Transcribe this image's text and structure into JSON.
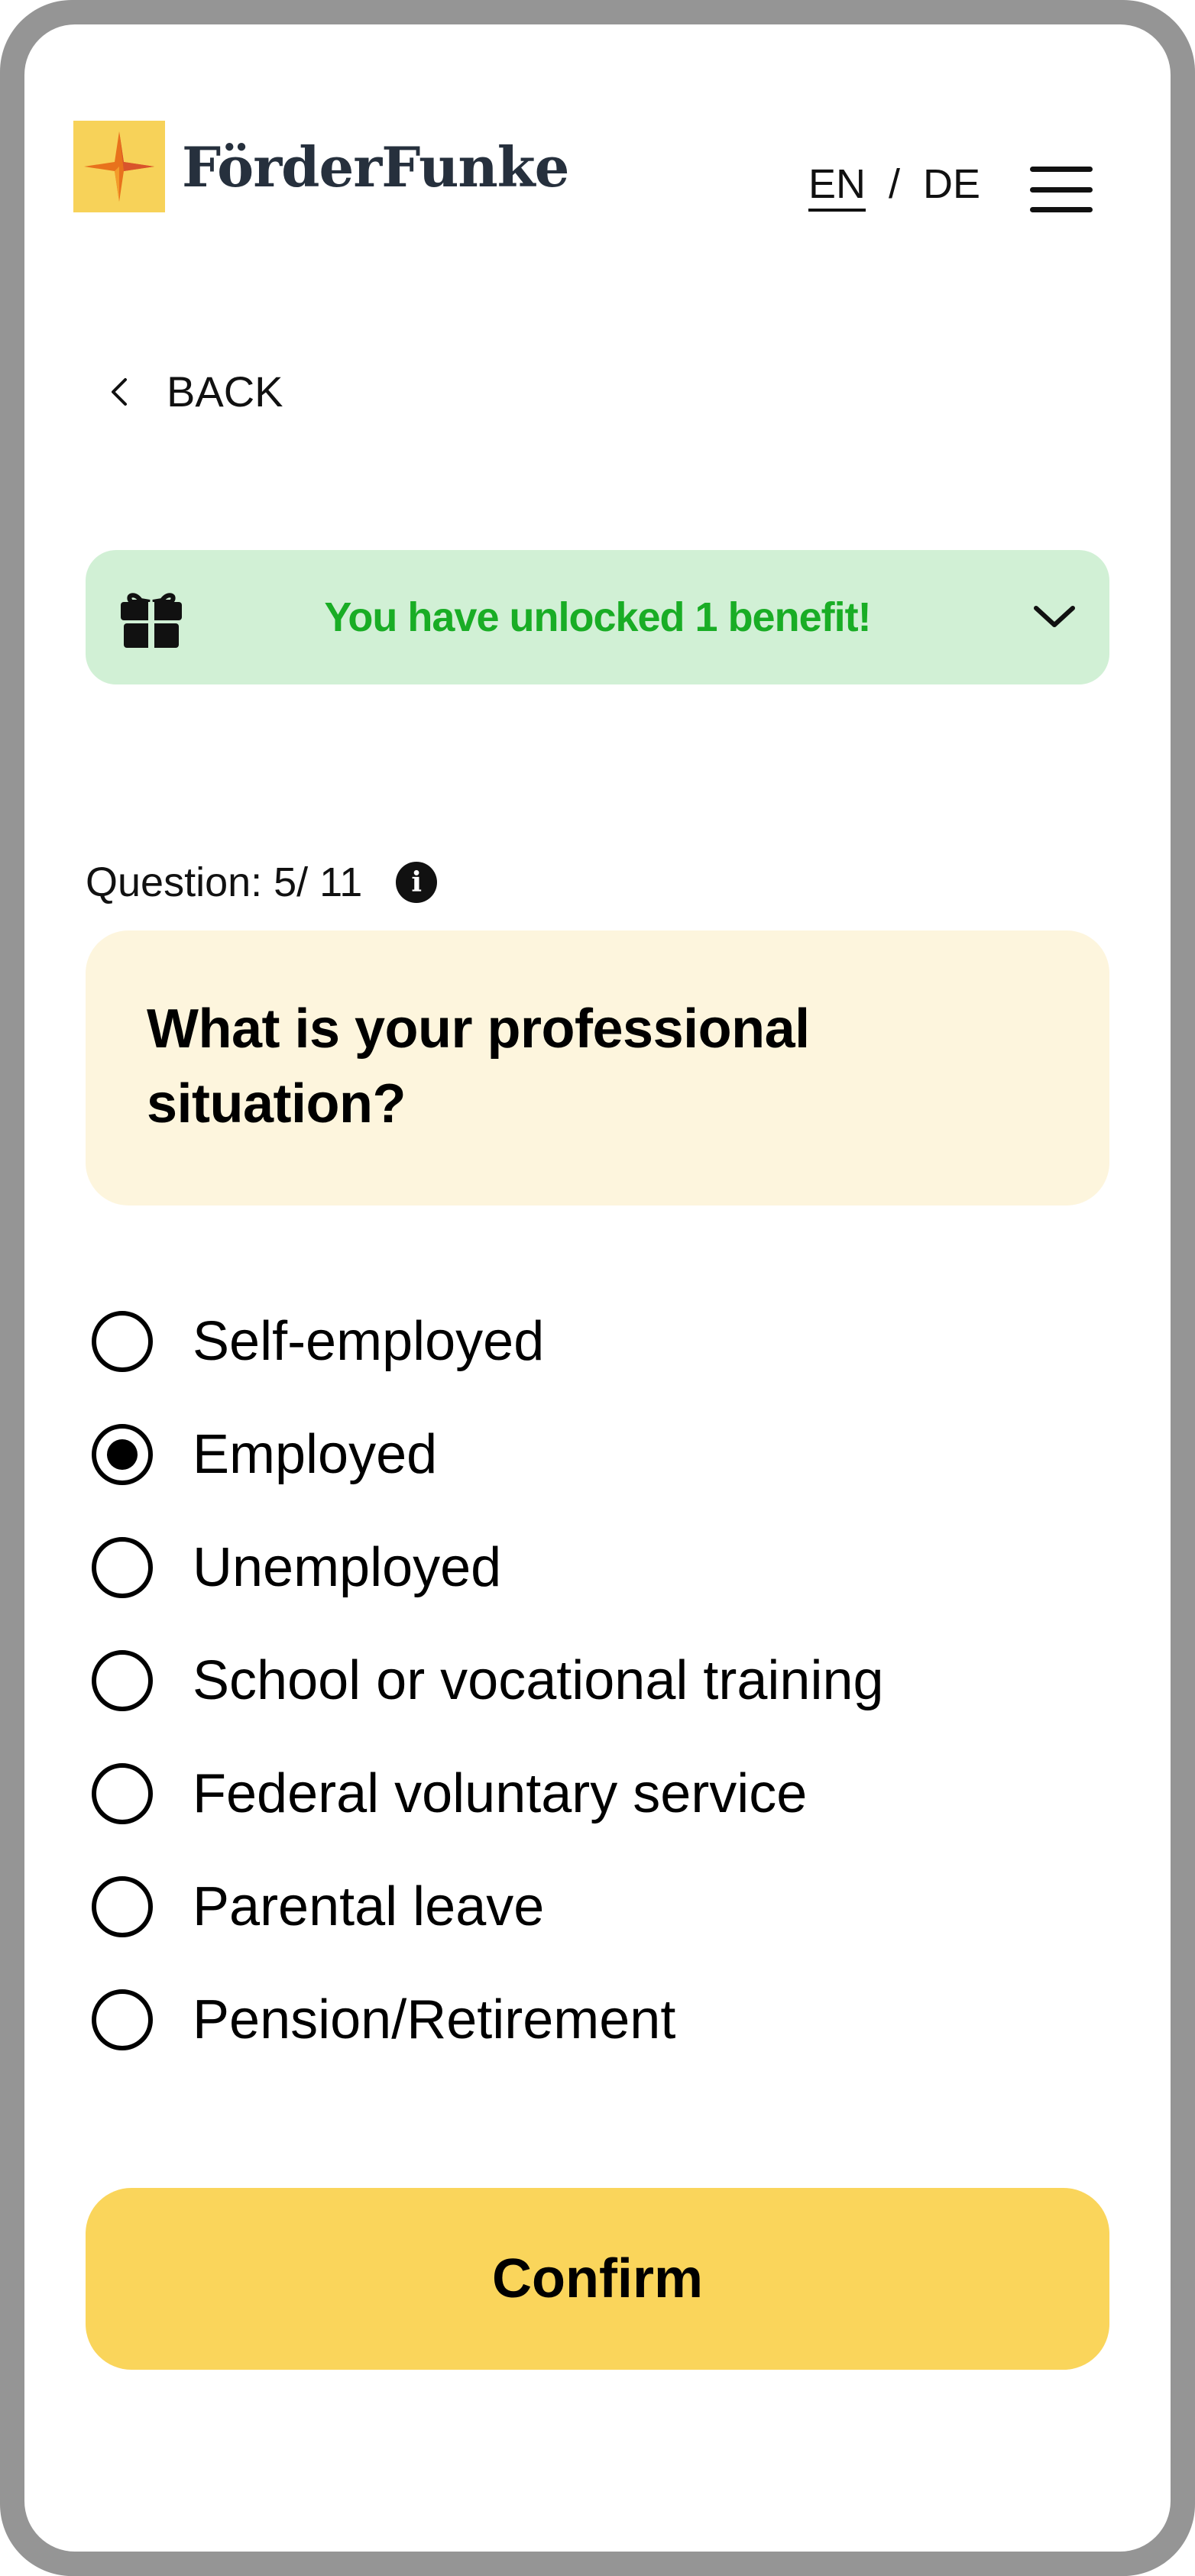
{
  "header": {
    "brand": "FörderFunke",
    "lang_en": "EN",
    "lang_separator": "/",
    "lang_de": "DE"
  },
  "nav": {
    "back_label": "BACK"
  },
  "benefit_banner": {
    "text": "You have unlocked 1 benefit!"
  },
  "question": {
    "counter": "Question: 5/ 11",
    "text": "What is your professional situation?"
  },
  "options": [
    {
      "label": "Self-employed",
      "selected": false
    },
    {
      "label": "Employed",
      "selected": true
    },
    {
      "label": "Unemployed",
      "selected": false
    },
    {
      "label": "School or vocational training",
      "selected": false
    },
    {
      "label": "Federal voluntary service",
      "selected": false
    },
    {
      "label": "Parental leave",
      "selected": false
    },
    {
      "label": "Pension/Retirement",
      "selected": false
    }
  ],
  "actions": {
    "confirm_label": "Confirm"
  },
  "colors": {
    "accent_yellow": "#fad55b",
    "benefit_bg": "#d1f0d5",
    "benefit_text": "#19ad25",
    "question_bg": "#fdf5dd",
    "brand_text": "#26303d"
  },
  "icons": {
    "logo": "spark-logo-icon",
    "gift": "gift-icon",
    "caret": "chevron-down-icon",
    "back": "chevron-left-icon",
    "menu": "hamburger-menu-icon",
    "info": "info-icon"
  }
}
